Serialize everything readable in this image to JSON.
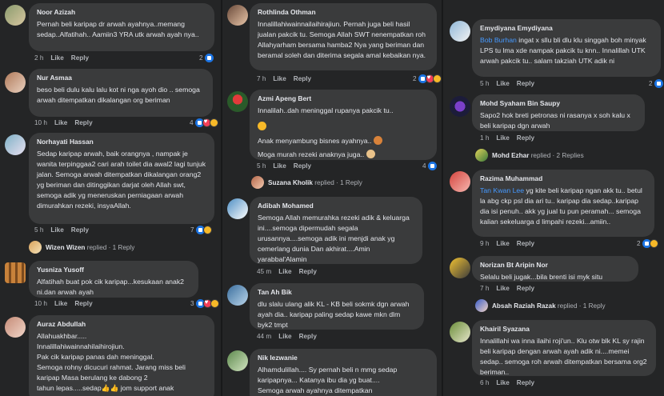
{
  "col1": [
    {
      "name": "Noor Azizah",
      "text": "Pernah beli karipap dr arwah ayahnya..memang sedap..Alfatihah.. Aamiin3 YRA utk arwah ayah nya..",
      "time": "2 h",
      "like": "Like",
      "reply": "Reply",
      "count": "2"
    },
    {
      "name": "Nur Asmaa",
      "text": "beso beli dulu kalu lalu kot ni nga ayoh dio .. semoga arwah ditempatkan dikalangan org beriman",
      "time": "10 h",
      "like": "Like",
      "reply": "Reply",
      "count": "4"
    },
    {
      "name": "Norhayati Hassan",
      "text": "Sedap karipap arwah, baik orangnya , nampak je wanita terpinggaa2 cari arah toilet dia awal2 lagi tunjuk jalan. Semoga arwah ditempatkan dikalangan orang2 yg beriman dan ditinggikan darjat oleh Allah swt, semoga adik yg meneruskan perniagaan  arwah dimurahkan rezeki, insyaAllah.",
      "time": "5 h",
      "like": "Like",
      "reply": "Reply",
      "count": "7",
      "replied_by": "Wizen Wizen",
      "replied_text": "replied · 1 Reply"
    },
    {
      "name": "Yusniza Yusoff",
      "text": "Alfatihah buat pok cik karipap...kesukaan anak2 ni.dan arwah ayah",
      "time": "10 h",
      "like": "Like",
      "reply": "Reply",
      "count": "3"
    },
    {
      "name": "Auraz Abdullah",
      "text": "Allahuakhbar.....\nInnalillahiwainnahilaihirojiun.\nPak cik karipap panas dah meninggal.\nSemoga rohny dicucuri rahmat. Jarang miss beli karipap Masa berulang ke dabong 2\ntahun lepas.....sedap👍👍 jom support anak"
    }
  ],
  "col2": [
    {
      "name": "Rothlinda Othman",
      "text": "Innalillahiwainnailaihirajiun. Pernah juga beli hasil jualan pakcik tu. Semoga Allah SWT nenempatkan roh Allahyarham bersama hamba2 Nya yang beriman dan beramal soleh dan diterima segala amal kebaikan nya.",
      "time": "7 h",
      "like": "Like",
      "reply": "Reply",
      "count": "2"
    },
    {
      "name": "Azmi Apeng Bert",
      "text": "Innalilah..dah meninggal rupanya pakcik tu..",
      "text2": "Anak menyambung bisnes ayahnya..",
      "text3": "Moga murah rezeki anaknya juga..",
      "time": "5 h",
      "like": "Like",
      "reply": "Reply",
      "count": "4",
      "replied_by": "Suzana Kholik",
      "replied_text": "replied · 1 Reply"
    },
    {
      "name": "Adibah Mohamed",
      "text": "Semoga Allah memurahka rezeki adik & keluarga ini....semoga dipermudah segala urusannya....semoga adik ini menjdi anak yg cemerlang dunia Dan akhirat....Amin yarabbal'Alamin",
      "time": "45 m",
      "like": "Like",
      "reply": "Reply"
    },
    {
      "name": "Tan Ah Bik",
      "text": "dlu slalu ulang alik KL - KB beli sokmk dgn arwah ayah dia.. karipap paling sedap kawe mkn dlm byk2 tmpt",
      "time": "44 m",
      "like": "Like",
      "reply": "Reply"
    },
    {
      "name": "Nik Iezwanie",
      "text": "Alhamdulillah.... Sy pernah beli n mmg sedap karipapnya... Katanya ibu dia yg buat....\nSemoga arwah ayahnya ditempatkan"
    }
  ],
  "col3": [
    {
      "name": "Emydiyana Emydiyana",
      "mention": "Bob Burhan",
      "text": " ingat x sllu bli dlu klu singgah boh minyak LPS tu lma xde nampak pakcik tu knn.. Innalillah UTK arwah pakcik tu.. salam takziah UTK adik ni",
      "time": "5 h",
      "like": "Like",
      "reply": "Reply",
      "count": "2"
    },
    {
      "name": "Mohd Syaham Bin Saupy",
      "text": "Sapo2 hok breti petronas ni rasanya x soh kalu x beli karipap dgn arwah",
      "time": "1 h",
      "like": "Like",
      "reply": "Reply",
      "replied_by": "Mohd Ezhar",
      "replied_text": "replied · 2 Replies"
    },
    {
      "name": "Razima Muhammad",
      "mention": "Tan Kwan Lee",
      "text": " yg kite beli karipap ngan akk tu.. betul la abg ckp psl dia ari tu.. karipap dia sedap..karipap dia isi penuh.. akk yg jual tu pun peramah... semoga kalian sekeluarga d limpahi rezeki...amiin..",
      "time": "9 h",
      "like": "Like",
      "reply": "Reply",
      "count": "2"
    },
    {
      "name": "Norizan Bt Aripin Nor",
      "text": "Selalu beli jugak...bila brenti isi myk situ",
      "time": "7 h",
      "like": "Like",
      "reply": "Reply",
      "replied_by": "Absah Raziah Razak",
      "replied_text": "replied · 1 Reply"
    },
    {
      "name": "Khairil Syazana",
      "text": "Innalillahi wa inna ilaihi roji'un.. Klu otw blk KL sy rajin beli karipap dengan arwah ayah adik ni....memei sedap.. semoga roh arwah ditempatkan bersama org2 beriman..",
      "time": "6 h",
      "like": "Like",
      "reply": "Reply"
    }
  ]
}
